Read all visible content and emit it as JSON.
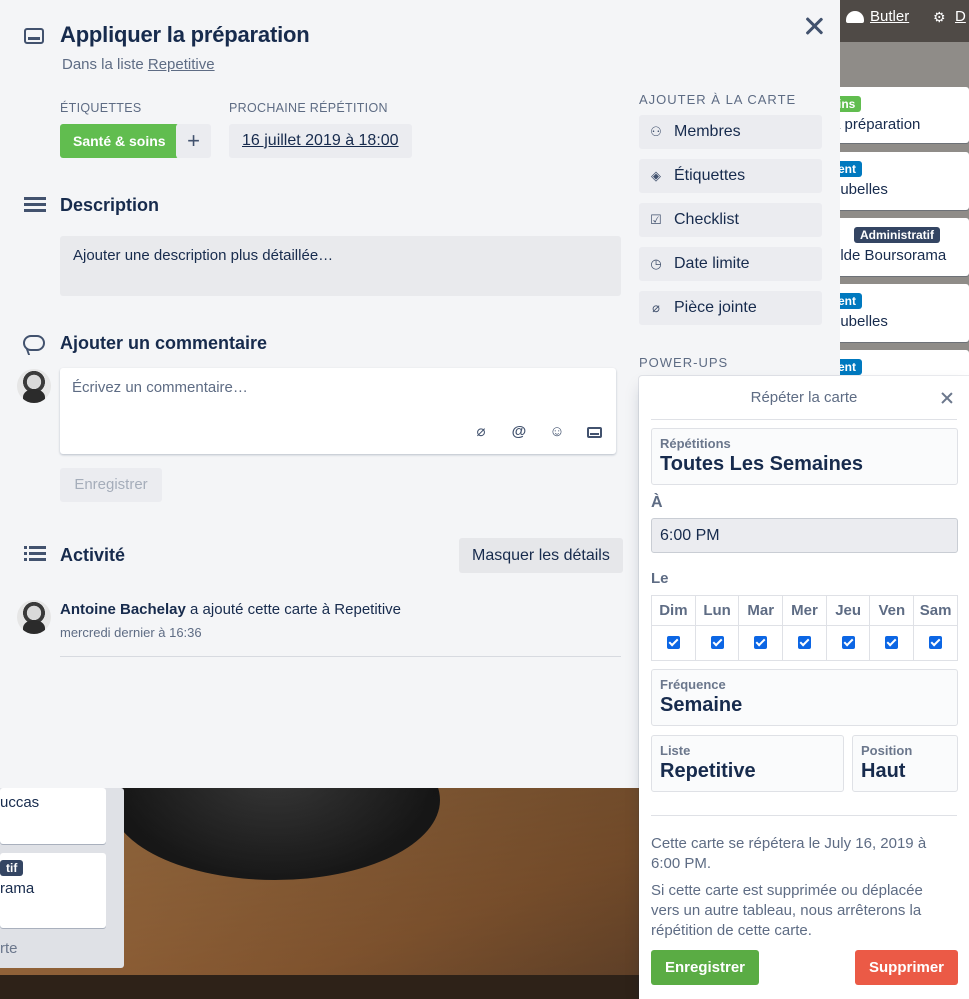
{
  "header": {
    "butler": "Butler",
    "other": "D"
  },
  "board_cards": [
    {
      "label": "ins",
      "label_color": "#61bd4f",
      "text": "a préparation"
    },
    {
      "label": "ent",
      "label_color": "#0079bf",
      "text": "oubelles"
    },
    {
      "label": "Administratif",
      "label_color": "#344563",
      "text": "olde Boursorama"
    },
    {
      "label": "ent",
      "label_color": "#0079bf",
      "text": "oubelles"
    },
    {
      "label": "ent",
      "label_color": "#0079bf",
      "text": ""
    }
  ],
  "left_cards": [
    {
      "label": "",
      "text": "uccas"
    },
    {
      "label": "tif",
      "text": "rama"
    }
  ],
  "left_footer": "rte",
  "card": {
    "title": "Appliquer la préparation",
    "in_list_prefix": "Dans la liste",
    "in_list_name": "Repetitive",
    "labels_heading": "ÉTIQUETTES",
    "label_name": "Santé & soins",
    "label_color": "#61bd4f",
    "add_label": "+",
    "next_heading": "PROCHAINE RÉPÉTITION",
    "next_date": "16 juillet 2019 à 18:00",
    "description_heading": "Description",
    "description_placeholder": "Ajouter une description plus détaillée…",
    "comment_heading": "Ajouter un commentaire",
    "comment_placeholder": "Écrivez un commentaire…",
    "save_label": "Enregistrer",
    "activity_heading": "Activité",
    "hide_details": "Masquer les détails",
    "activity": {
      "user": "Antoine Bachelay",
      "action": "a ajouté cette carte à Repetitive",
      "time": "mercredi dernier à 16:36"
    }
  },
  "sidebar": {
    "add_heading": "AJOUTER À LA CARTE",
    "items": [
      {
        "label": "Membres",
        "icon": "person-icon"
      },
      {
        "label": "Étiquettes",
        "icon": "tag-icon"
      },
      {
        "label": "Checklist",
        "icon": "checklist-icon"
      },
      {
        "label": "Date limite",
        "icon": "clock-icon"
      },
      {
        "label": "Pièce jointe",
        "icon": "paperclip-icon"
      }
    ],
    "powerups_heading": "POWER-UPS"
  },
  "repeat": {
    "title": "Répéter la carte",
    "repetitions_label": "Répétitions",
    "repetitions_value": "Toutes Les Semaines",
    "time_label": "À",
    "time_value": "6:00 PM",
    "days_label": "Le",
    "days": [
      "Dim",
      "Lun",
      "Mar",
      "Mer",
      "Jeu",
      "Ven",
      "Sam"
    ],
    "days_checked": [
      true,
      true,
      true,
      true,
      true,
      true,
      true
    ],
    "frequency_label": "Fréquence",
    "frequency_value": "Semaine",
    "list_label": "Liste",
    "list_value": "Repetitive",
    "position_label": "Position",
    "position_value": "Haut",
    "info1": "Cette carte se répétera le July 16, 2019 à 6:00 PM.",
    "info2": "Si cette carte est supprimée ou déplacée vers un autre tableau, nous arrêterons la répétition de cette carte.",
    "save": "Enregistrer",
    "save_color": "#5aac44",
    "delete": "Supprimer",
    "delete_color": "#eb5a46"
  }
}
